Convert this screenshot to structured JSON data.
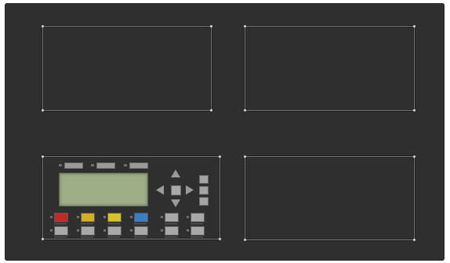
{
  "panel": {
    "background": "#2f2f2f",
    "slots": [
      {
        "name": "slot-top-left",
        "state": "empty"
      },
      {
        "name": "slot-top-right",
        "state": "empty"
      },
      {
        "name": "slot-bottom-right",
        "state": "empty"
      }
    ]
  },
  "operator_module": {
    "lcd_color": "#9eae86",
    "softkeys": 3,
    "nav_keys": [
      "up",
      "down",
      "left",
      "right",
      "center"
    ],
    "side_keys": 3,
    "function_keys_row1": [
      {
        "color": "#c62828"
      },
      {
        "color": "#d4b020"
      },
      {
        "color": "#d4c428"
      },
      {
        "color": "#3a7fc4"
      },
      {
        "color": "#a8a8a8"
      },
      {
        "color": "#a8a8a8"
      }
    ],
    "function_keys_row2": [
      {
        "color": "#a8a8a8"
      },
      {
        "color": "#a8a8a8"
      },
      {
        "color": "#a8a8a8"
      },
      {
        "color": "#a8a8a8"
      },
      {
        "color": "#a8a8a8"
      },
      {
        "color": "#a8a8a8"
      }
    ]
  }
}
